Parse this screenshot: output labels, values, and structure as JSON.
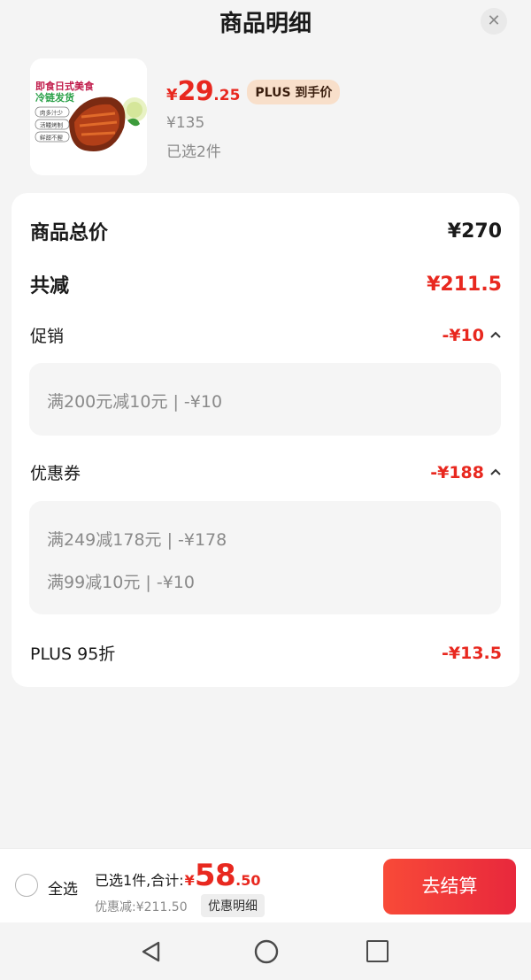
{
  "header": {
    "title": "商品明细",
    "close_icon": "close-icon"
  },
  "product": {
    "image_text": {
      "line1": "即食日式美食",
      "line2": "冷链发货",
      "tags": [
        "肉多汁少",
        "活鳗烤制",
        "鲜甜不腥"
      ]
    },
    "price_symbol": "¥",
    "price_integer": "29",
    "price_decimal": ".25",
    "plus_badge": "PLUS 到手价",
    "original_price": "¥135",
    "selected_count": "已选2件"
  },
  "summary": {
    "total_label": "商品总价",
    "total_value": "¥270",
    "reduce_label": "共减",
    "reduce_value": "¥211.5",
    "promo_label": "促销",
    "promo_value": "-¥10",
    "promo_items": [
      "满200元减10元 | -¥10"
    ],
    "coupon_label": "优惠券",
    "coupon_value": "-¥188",
    "coupon_items": [
      "满249减178元 | -¥178",
      "满99减10元 | -¥10"
    ],
    "plus_label": "PLUS 95折",
    "plus_value": "-¥13.5"
  },
  "bottom_bar": {
    "select_all": "全选",
    "total_prefix": "已选1件,合计:",
    "total_symbol": "¥",
    "total_integer": "58",
    "total_decimal": ".50",
    "discount_text": "优惠减:¥211.50",
    "detail_tag": "优惠明细",
    "checkout": "去结算"
  },
  "colors": {
    "accent_red": "#e8281f",
    "badge_bg": "#f8dfca"
  }
}
